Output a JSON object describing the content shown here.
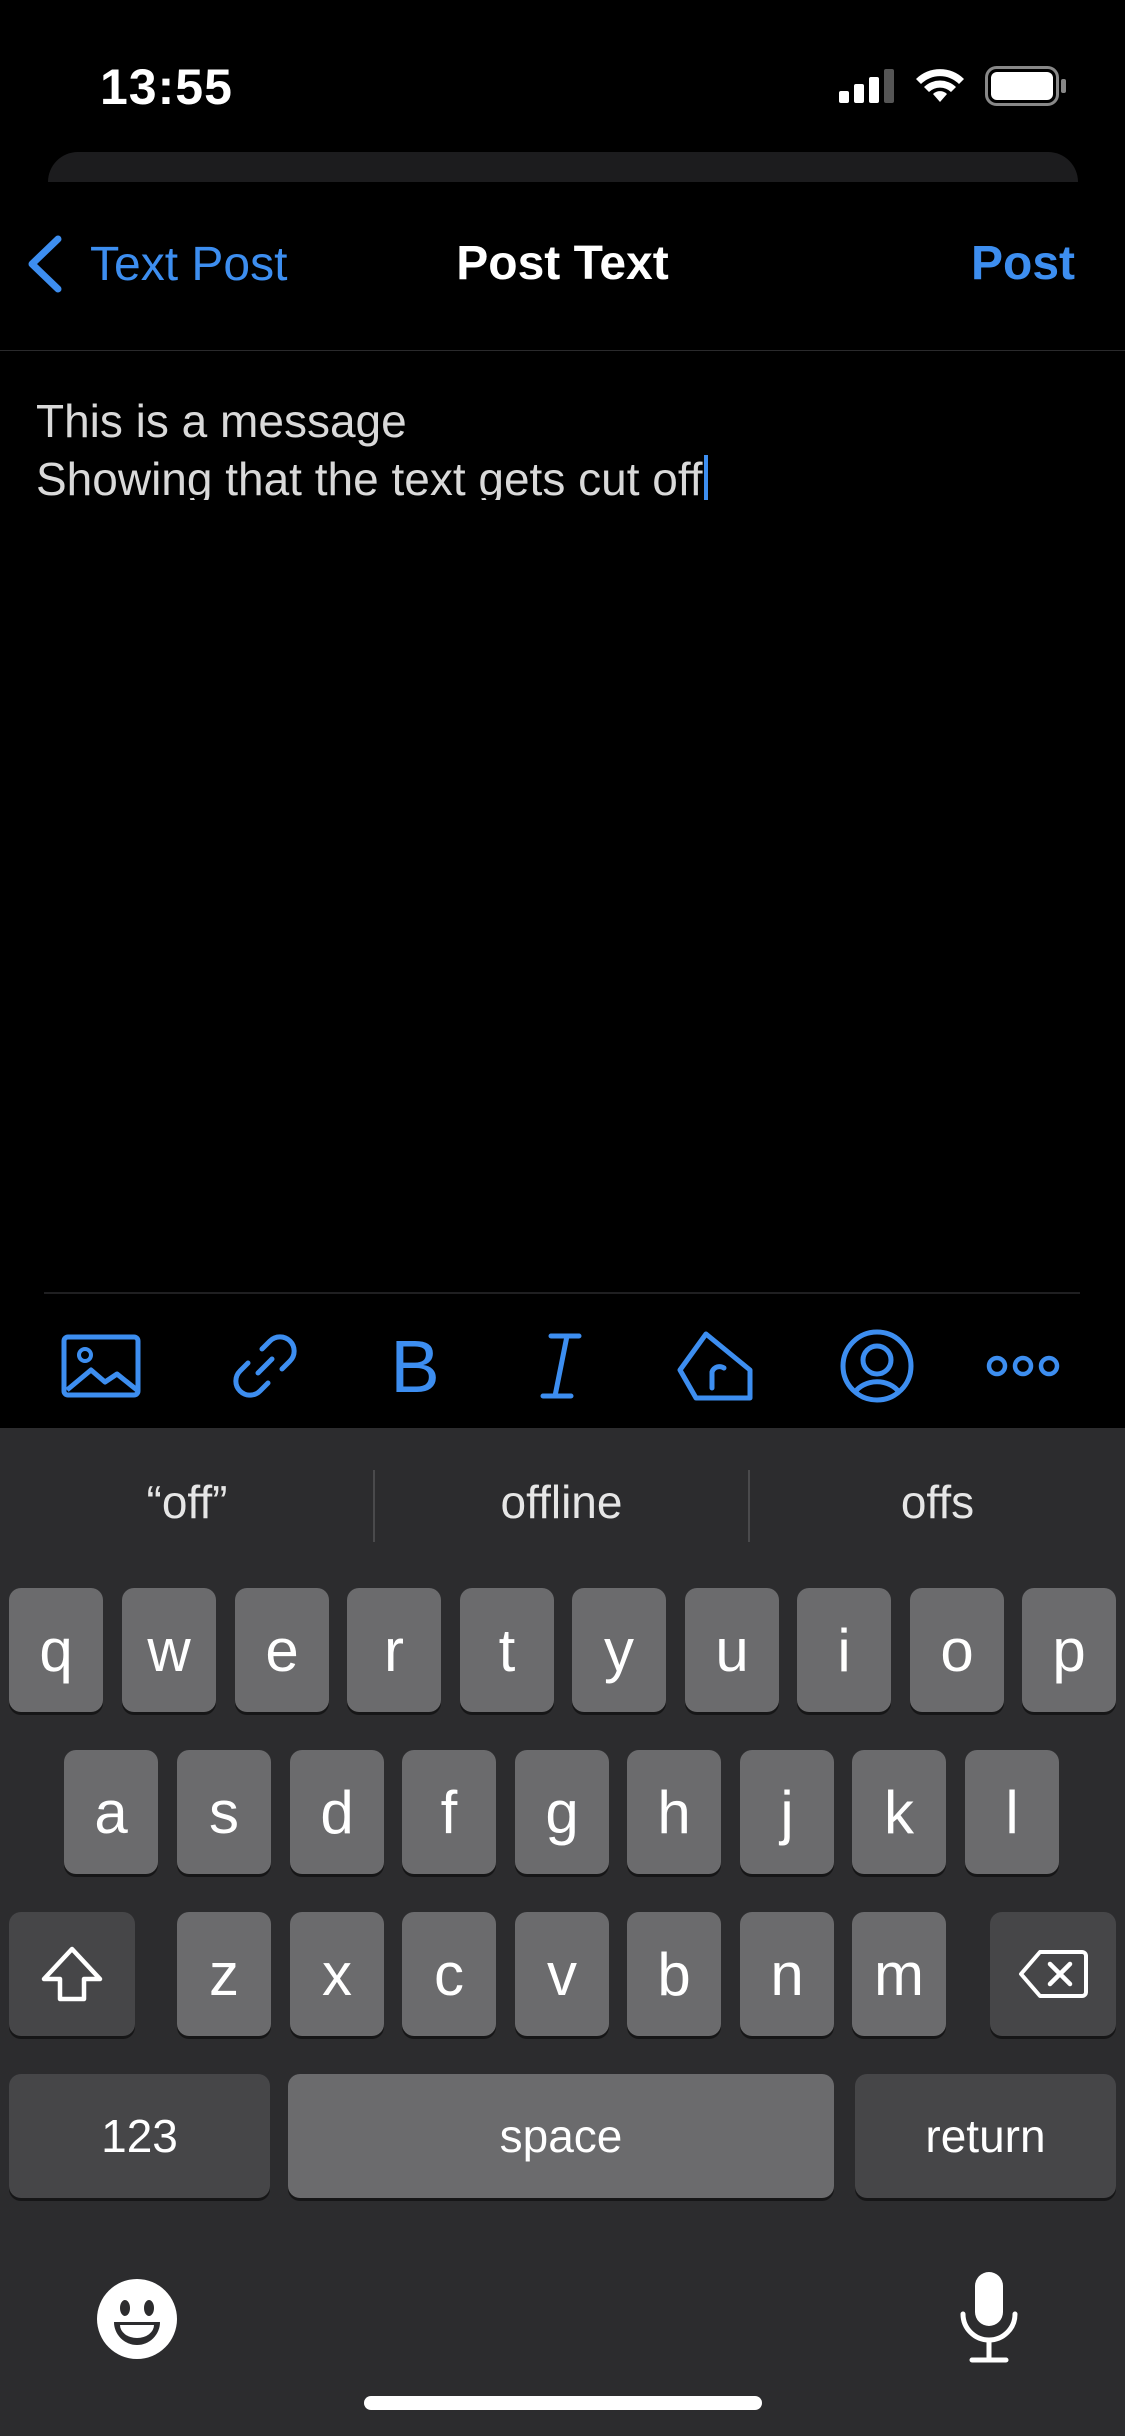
{
  "status": {
    "time": "13:55"
  },
  "nav": {
    "back_label": "Text Post",
    "title": "Post Text",
    "post_label": "Post"
  },
  "editor": {
    "line1": "This is a message",
    "line2": "Showing that the text gets cut off"
  },
  "toolbar": {
    "icons": [
      "image-icon",
      "link-icon",
      "bold-icon",
      "italic-icon",
      "tag-icon",
      "mention-icon",
      "more-icon"
    ],
    "bold_glyph": "B",
    "italic_glyph": "I"
  },
  "keyboard": {
    "suggestions": [
      "“off”",
      "offline",
      "offs"
    ],
    "row1": [
      "q",
      "w",
      "e",
      "r",
      "t",
      "y",
      "u",
      "i",
      "o",
      "p"
    ],
    "row2": [
      "a",
      "s",
      "d",
      "f",
      "g",
      "h",
      "j",
      "k",
      "l"
    ],
    "row3": [
      "z",
      "x",
      "c",
      "v",
      "b",
      "n",
      "m"
    ],
    "numbers_label": "123",
    "space_label": "space",
    "return_label": "return"
  },
  "colors": {
    "accent": "#3d8ef0",
    "keyboard_bg": "#2c2c2e",
    "key_bg": "#6b6b6d",
    "key_dark_bg": "#464648"
  }
}
